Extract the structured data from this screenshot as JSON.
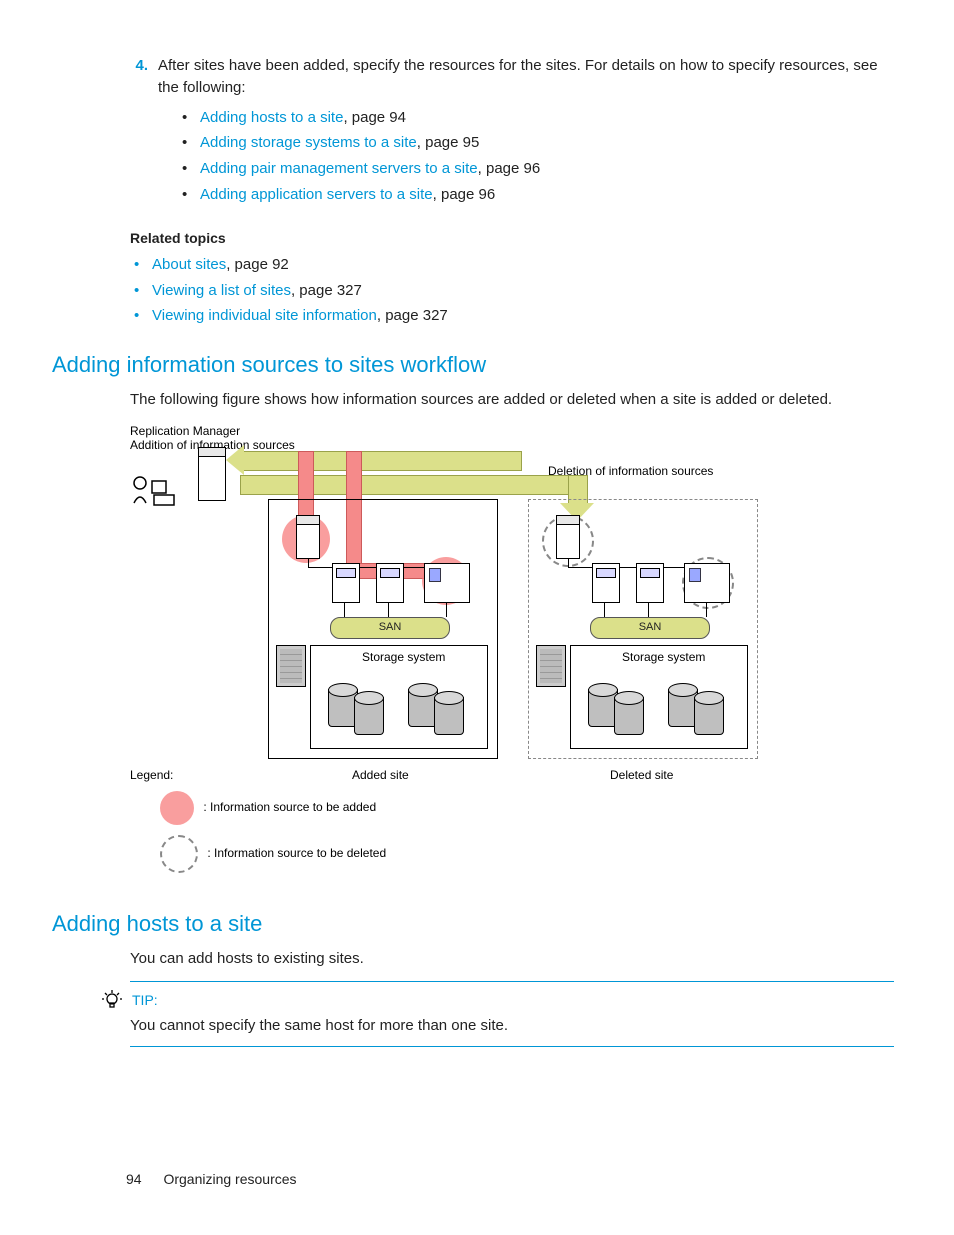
{
  "step4": {
    "number": "4.",
    "text": "After sites have been added, specify the resources for the sites. For details on how to specify resources, see the following:",
    "bullets": [
      {
        "link": "Adding hosts to a site",
        "suffix": ", page 94"
      },
      {
        "link": "Adding storage systems to a site",
        "suffix": ", page 95"
      },
      {
        "link": "Adding pair management servers to a site",
        "suffix": ", page 96"
      },
      {
        "link": "Adding application servers to a site",
        "suffix": ", page 96"
      }
    ]
  },
  "related": {
    "heading": "Related topics",
    "items": [
      {
        "link": "About sites",
        "suffix": ", page 92"
      },
      {
        "link": "Viewing a list of sites",
        "suffix": ", page 327"
      },
      {
        "link": "Viewing individual site information",
        "suffix": ", page 327"
      }
    ]
  },
  "section1": {
    "title": "Adding information sources to sites workflow",
    "para": "The following figure shows how information sources are added or deleted when a site is added or deleted."
  },
  "figure": {
    "labels": {
      "replication_manager": "Replication Manager",
      "addition": "Addition of information sources",
      "deletion": "Deletion of information sources",
      "san": "SAN",
      "storage_system": "Storage system",
      "added_site": "Added site",
      "deleted_site": "Deleted site",
      "legend": "Legend:",
      "legend_add": ": Information source to be added",
      "legend_del": ": Information source to be deleted"
    }
  },
  "section2": {
    "title": "Adding hosts to a site",
    "para": "You can add hosts to existing sites."
  },
  "tip": {
    "label": "TIP:",
    "text": "You cannot specify the same host for more than one site."
  },
  "footer": {
    "page": "94",
    "chapter": "Organizing resources"
  }
}
